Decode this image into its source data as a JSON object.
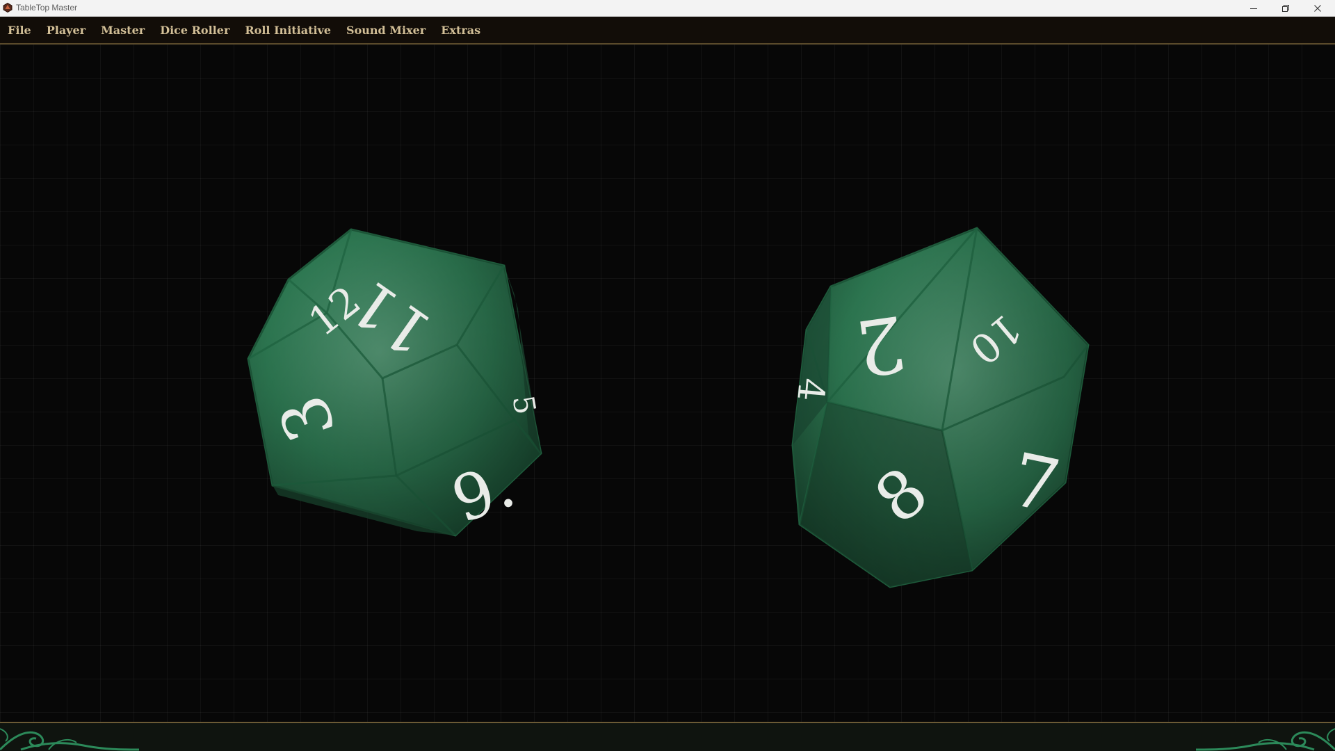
{
  "window": {
    "title": "TableTop Master",
    "icon": "d20-app-icon",
    "controls": [
      "minimize-icon",
      "restore-icon",
      "close-icon"
    ]
  },
  "menu": {
    "items": [
      {
        "label": "File"
      },
      {
        "label": "Player"
      },
      {
        "label": "Master"
      },
      {
        "label": "Dice Roller"
      },
      {
        "label": "Roll Initiative"
      },
      {
        "label": "Sound Mixer"
      },
      {
        "label": "Extras"
      }
    ]
  },
  "dice": [
    {
      "type": "d12",
      "color": "#2e8a5c",
      "faces": [
        "12",
        "11",
        "3",
        "9.",
        "5"
      ]
    },
    {
      "type": "d12",
      "color": "#2e8a5c",
      "faces": [
        "2",
        "10",
        "4",
        "8",
        "7"
      ]
    }
  ],
  "colors": {
    "menu_text": "#d2bf97",
    "menu_bg": "#120d08",
    "stage_bg": "#070707",
    "accent_gold": "#6b5a35",
    "die_green": "#2e8a5c"
  }
}
